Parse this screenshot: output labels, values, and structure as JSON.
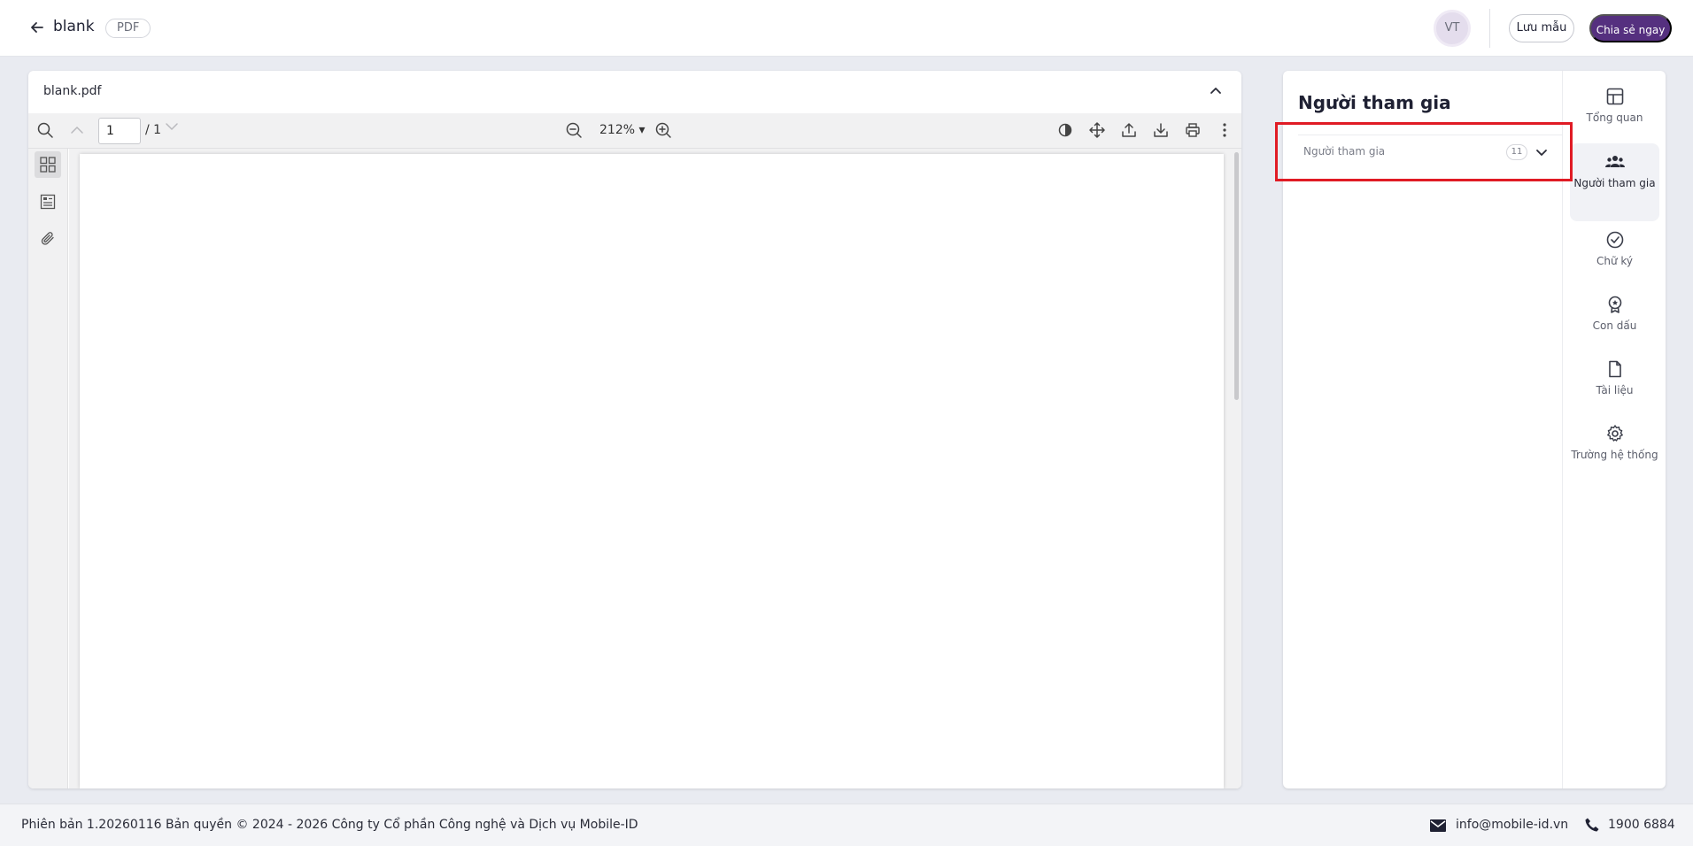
{
  "header": {
    "title": "blank",
    "doc_type_badge": "PDF",
    "avatar_initials": "VT",
    "save_template_label": "Lưu mẫu",
    "share_now_label": "Chia sẻ ngay"
  },
  "viewer": {
    "file_name": "blank.pdf",
    "current_page": "1",
    "total_pages": "/ 1",
    "zoom_level": "212% ▾"
  },
  "panel": {
    "title": "Người tham gia",
    "participants_section": {
      "label": "Người tham gia",
      "count": "11"
    },
    "nav": [
      {
        "label": "Tổng quan",
        "icon": "layout-icon"
      },
      {
        "label": "Người tham gia",
        "icon": "people-icon"
      },
      {
        "label": "Chữ ký",
        "icon": "check-circle-icon"
      },
      {
        "label": "Con dấu",
        "icon": "seal-icon"
      },
      {
        "label": "Tài liệu",
        "icon": "file-icon"
      },
      {
        "label": "Trường hệ thống",
        "icon": "gear-icon"
      }
    ]
  },
  "footer": {
    "copyright": "Phiên bản 1.20260116 Bản quyền © 2024 - 2026 Công ty Cổ phần Công nghệ và Dịch vụ Mobile-ID",
    "email": "info@mobile-id.vn",
    "phone": "1900 6884"
  },
  "colors": {
    "accent": "#55307f",
    "highlight": "#e01b24",
    "background": "#e9ebf1"
  }
}
